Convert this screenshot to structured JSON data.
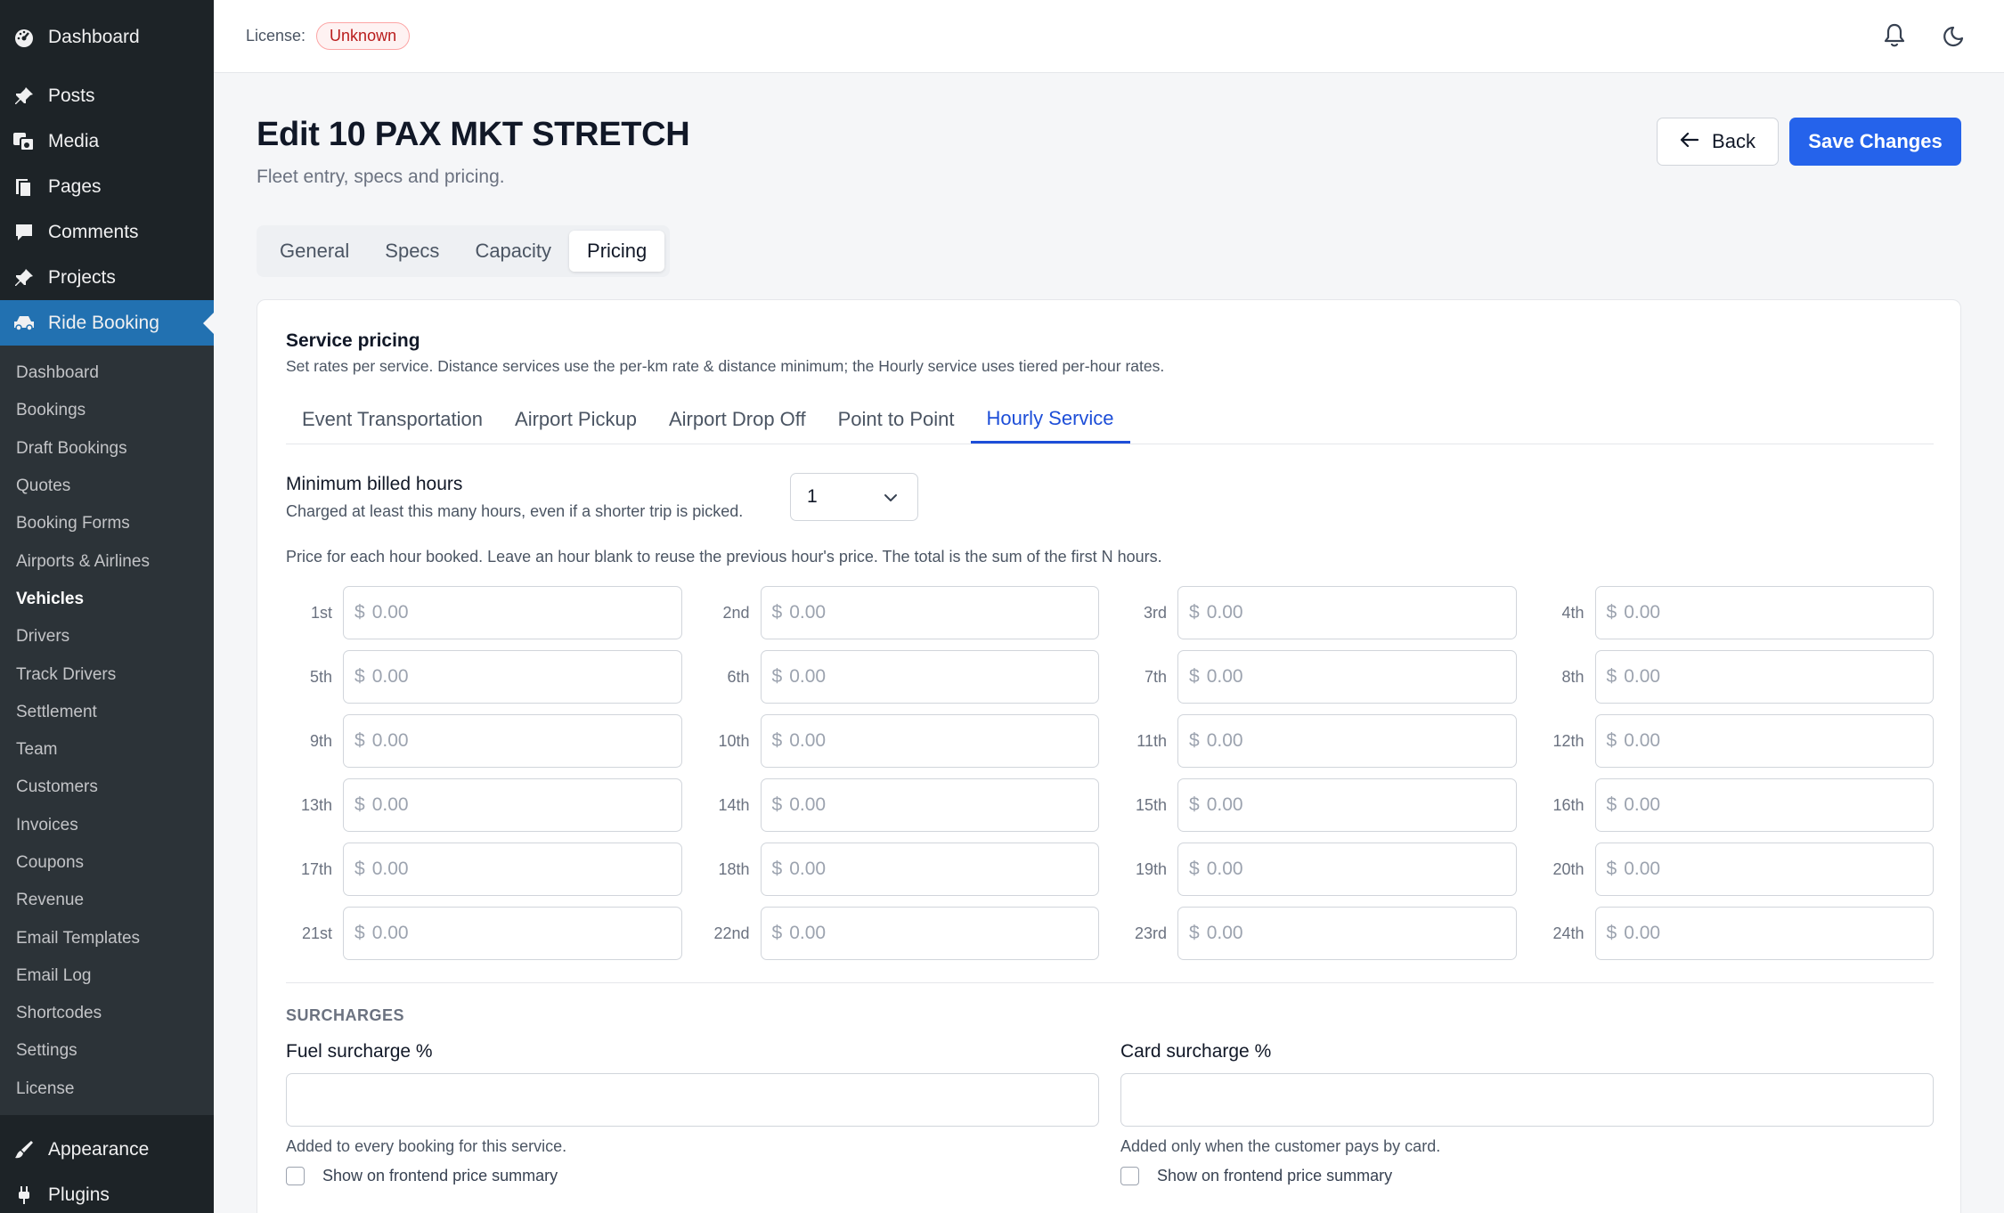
{
  "sidebar": {
    "top_items": [
      {
        "label": "Dashboard",
        "icon": "gauge-icon"
      },
      {
        "label": "Posts",
        "icon": "pushpin-icon"
      },
      {
        "label": "Media",
        "icon": "media-icon"
      },
      {
        "label": "Pages",
        "icon": "pages-icon"
      },
      {
        "label": "Comments",
        "icon": "comment-icon"
      },
      {
        "label": "Projects",
        "icon": "pushpin-icon"
      },
      {
        "label": "Ride Booking",
        "icon": "car-icon"
      }
    ],
    "submenu": [
      "Dashboard",
      "Bookings",
      "Draft Bookings",
      "Quotes",
      "Booking Forms",
      "Airports & Airlines",
      "Vehicles",
      "Drivers",
      "Track Drivers",
      "Settlement",
      "Team",
      "Customers",
      "Invoices",
      "Coupons",
      "Revenue",
      "Email Templates",
      "Email Log",
      "Shortcodes",
      "Settings",
      "License"
    ],
    "current_submenu": "Vehicles",
    "bottom_items": [
      {
        "label": "Appearance",
        "icon": "brush-icon"
      },
      {
        "label": "Plugins",
        "icon": "plugin-icon"
      }
    ]
  },
  "topbar": {
    "license_label": "License:",
    "license_status": "Unknown"
  },
  "page": {
    "title": "Edit 10 PAX MKT STRETCH",
    "subtitle": "Fleet entry, specs and pricing.",
    "back_label": "Back",
    "save_label": "Save Changes"
  },
  "main_tabs": [
    "General",
    "Specs",
    "Capacity",
    "Pricing"
  ],
  "active_main_tab": "Pricing",
  "pricing": {
    "title": "Service pricing",
    "description": "Set rates per service. Distance services use the per-km rate & distance minimum; the Hourly service uses tiered per-hour rates.",
    "service_tabs": [
      "Event Transportation",
      "Airport Pickup",
      "Airport Drop Off",
      "Point to Point",
      "Hourly Service"
    ],
    "active_service_tab": "Hourly Service",
    "min_hours_label": "Minimum billed hours",
    "min_hours_help": "Charged at least this many hours, even if a shorter trip is picked.",
    "min_hours_value": "1",
    "hourly_note": "Price for each hour booked. Leave an hour blank to reuse the previous hour's price. The total is the sum of the first N hours.",
    "currency_symbol": "$",
    "price_placeholder": "0.00",
    "hours": [
      "1st",
      "2nd",
      "3rd",
      "4th",
      "5th",
      "6th",
      "7th",
      "8th",
      "9th",
      "10th",
      "11th",
      "12th",
      "13th",
      "14th",
      "15th",
      "16th",
      "17th",
      "18th",
      "19th",
      "20th",
      "21st",
      "22nd",
      "23rd",
      "24th"
    ]
  },
  "surcharges": {
    "heading": "SURCHARGES",
    "fuel": {
      "label": "Fuel surcharge %",
      "value": "",
      "help": "Added to every booking for this service.",
      "checkbox_label": "Show on frontend price summary"
    },
    "card": {
      "label": "Card surcharge %",
      "value": "",
      "help": "Added only when the customer pays by card.",
      "checkbox_label": "Show on frontend price summary"
    }
  },
  "colors": {
    "sidebar_bg": "#1d2327",
    "sidebar_active": "#2271b1",
    "primary": "#2563eb",
    "tab_active": "#1d4ed8",
    "badge_text": "#b91c1c"
  }
}
